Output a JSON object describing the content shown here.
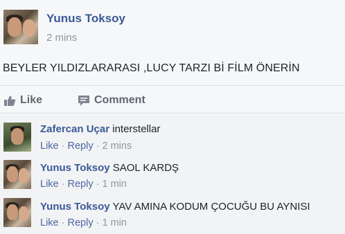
{
  "post": {
    "author": "Yunus Toksoy",
    "time": "2 mins",
    "text": "BEYLER YILDIZLARARASI ,LUCY TARZI Bİ FİLM ÖNERİN"
  },
  "actions": {
    "like": "Like",
    "comment": "Comment"
  },
  "comments": [
    {
      "author": "Zafercan Uçar",
      "text": "interstellar",
      "like": "Like",
      "reply": "Reply",
      "sep": "·",
      "time": "2 mins"
    },
    {
      "author": "Yunus Toksoy",
      "text": "SAOL KARDŞ",
      "like": "Like",
      "reply": "Reply",
      "sep": "·",
      "time": "1 min"
    },
    {
      "author": "Yunus Toksoy",
      "text": "YAV AMINA KODUM ÇOCUĞU BU AYNISI",
      "like": "Like",
      "reply": "Reply",
      "sep": "·",
      "time": "1 min"
    }
  ],
  "icons": {
    "like": "thumbs-up-icon",
    "comment": "speech-bubble-icon"
  },
  "colors": {
    "link": "#3b5998",
    "muted": "#90949c",
    "background": "#f6f7f9"
  }
}
